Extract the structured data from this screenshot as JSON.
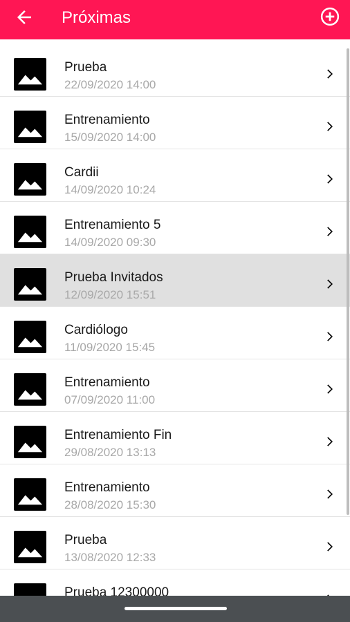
{
  "header": {
    "title": "Próximas",
    "back_icon": "arrow-left-icon",
    "add_icon": "add-circle-icon",
    "color": "#FF1654"
  },
  "items": [
    {
      "name": "Prueba",
      "date": "22/09/2020 14:00"
    },
    {
      "name": "Entrenamiento",
      "date": "15/09/2020 14:00"
    },
    {
      "name": "Cardii",
      "date": "14/09/2020 10:24"
    },
    {
      "name": "Entrenamiento 5",
      "date": "14/09/2020 09:30"
    },
    {
      "name": "Prueba Invitados",
      "date": "12/09/2020 15:51",
      "selected": true
    },
    {
      "name": "Cardiólogo",
      "date": "11/09/2020 15:45"
    },
    {
      "name": "Entrenamiento",
      "date": "07/09/2020 11:00"
    },
    {
      "name": "Entrenamiento Fin",
      "date": "29/08/2020 13:13"
    },
    {
      "name": "Entrenamiento",
      "date": "28/08/2020 15:30"
    },
    {
      "name": "Prueba",
      "date": "13/08/2020 12:33"
    },
    {
      "name": "Prueba 12300000",
      "date": ""
    }
  ],
  "icons": {
    "item_image": "image-placeholder-icon",
    "item_chevron": "chevron-right-icon"
  },
  "system_nav": {
    "handle": "gesture-handle"
  }
}
